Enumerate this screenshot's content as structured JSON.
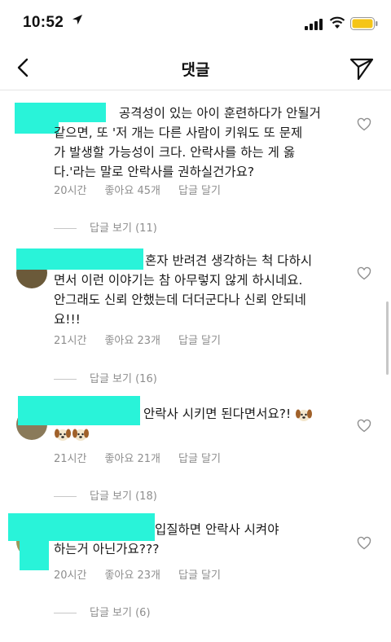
{
  "status": {
    "time": "10:52"
  },
  "header": {
    "title": "댓글"
  },
  "comments": [
    {
      "lines": [
        "공격성이 있는 아이 훈련하다가 안될거",
        "같으면, 또 '저 개는 다른 사람이 키워도 또 문제",
        "가 발생할 가능성이 크다. 안락사를 하는 게 옳",
        "다.'라는 말로 안락사를 권하실건가요?"
      ],
      "time": "20시간",
      "likes": "좋아요 45개",
      "reply": "답글 달기",
      "view_replies": "답글 보기 (11)"
    },
    {
      "lines": [
        "혼자 반려견 생각하는 척 다하시",
        "면서 이런 이야기는 참 아무렇지 않게 하시네요.",
        "안그래도 신뢰 안했는데 더더군다나 신뢰 안되네",
        "요!!!"
      ],
      "time": "21시간",
      "likes": "좋아요 23개",
      "reply": "답글 달기",
      "view_replies": "답글 보기 (16)"
    },
    {
      "lines": [
        "안락사 시키면 된다면서요?!"
      ],
      "time": "21시간",
      "likes": "좋아요 21개",
      "reply": "답글 달기",
      "view_replies": "답글 보기 (18)"
    },
    {
      "lines": [
        "입질하면 안락사 시켜야",
        "하는거 아닌가요???"
      ],
      "time": "20시간",
      "likes": "좋아요 23개",
      "reply": "답글 달기",
      "view_replies": "답글 보기 (6)"
    }
  ],
  "colors": {
    "redaction": "#29f3d9",
    "muted": "#8e8e8e",
    "battery": "#f5c518"
  }
}
